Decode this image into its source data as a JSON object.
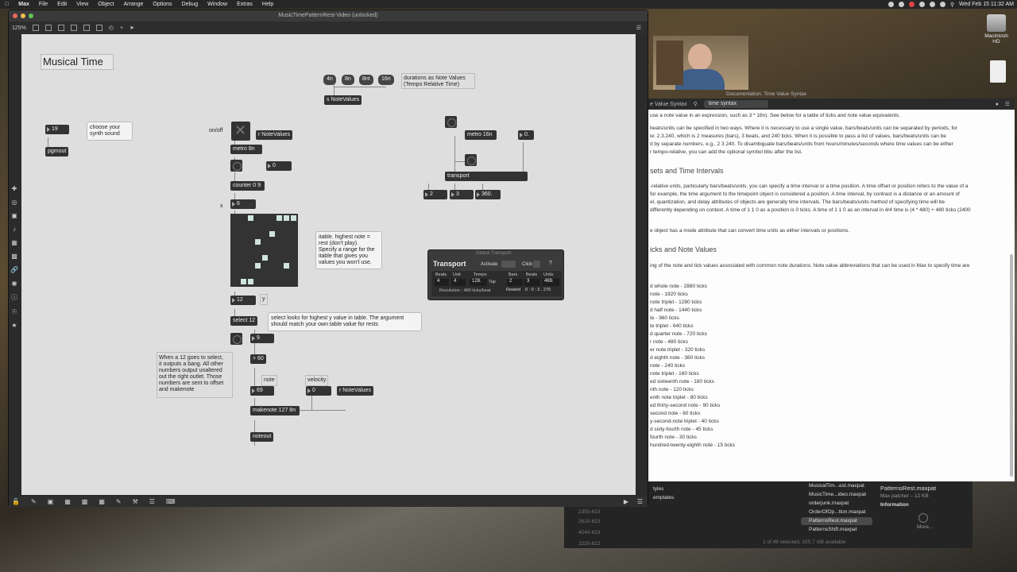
{
  "menubar": {
    "app": "Max",
    "items": [
      "File",
      "Edit",
      "View",
      "Object",
      "Arrange",
      "Options",
      "Debug",
      "Window",
      "Extras",
      "Help"
    ],
    "clock": "Wed Feb 15  11:32 AM"
  },
  "window": {
    "title": "MusicTimePatternRest-Video (unlocked)",
    "zoom": "125%"
  },
  "patch": {
    "heading": "Musical Time",
    "msg_4n": "4n",
    "msg_8n": "8n",
    "msg_8nt": "8nt",
    "msg_16n": "16n",
    "durations_comment": "durations as Note Values\n(Tempo Relative Time)",
    "s_notevalues": "s NoteValues",
    "num_19": "19",
    "pgmout": "pgmout",
    "synth_comment": "choose your\nsynth sound",
    "onoff": "on/off",
    "r_notevalues_1": "r NoteValues",
    "metro_8n": "metro 8n",
    "num_0_a": "0",
    "counter": "counter 0 9",
    "num_6": "6",
    "x_label": "x",
    "itable_comment": "itable. highest note =\nrest (don't play).\nSpecify a range for the\nitable that gives you\nvalues you won't use.",
    "num_12": "12",
    "y_label": "y",
    "select_12": "select 12",
    "select_comment": "select looks for highest y value in table. The argument\nshould match your own table value for rests",
    "num_9": "9",
    "plus_60": "+ 60",
    "bang_comment": "When a 12 goes to select,\nit outputs a bang. All other\nnumbers output unaltered\nout the right outlet. Those\nnumbers are sent to offset\nand makenote",
    "note_label": "note",
    "velocity_label": "velocity",
    "num_69": "69",
    "num_0_b": "0",
    "r_notevalues_2": "r NoteValues",
    "makenote": "makenote 127 8n",
    "noteout": "noteout",
    "metro_16n": "metro 16n",
    "num_0_c": "0.",
    "transport": "transport",
    "num_2": "2",
    "num_3": "3",
    "num_360": "360."
  },
  "global_transport": {
    "window_title": "Global Transport",
    "title": "Transport",
    "activate": "Activate",
    "click": "Click",
    "help": "?",
    "beats_label": "Beats",
    "unit_label": "Unit",
    "tempo_label": "Tempo",
    "bars_label": "Bars",
    "beats2_label": "Beats",
    "units_label": "Units",
    "beats_val": "4",
    "unit_val": "4",
    "tempo_val": "128.",
    "tap": "Tap",
    "bars_val": "2",
    "beats2_val": "3",
    "units_val": "469.",
    "resolution": "Resolution : 480 ticks/beat",
    "rewind": "Rewind",
    "time": "0 : 0 : 3 . 270"
  },
  "docs": {
    "window_title": "Documentation: Time Value Syntax",
    "tab": "e Value Syntax",
    "search_value": "time syntax",
    "para_top": "use a note value in an expression, such as 3 * 16n). See below for a table of ticks and note value equivalents.",
    "para_bbu_1": "beats/units can be specified in two ways. Where it is necessary to use a single value, bars/beats/units can be separated by periods, for",
    "para_bbu_2": "le: 2.3.240, which is 2 measures (bars), 3 beats, and 240 ticks. When it is possible to pass a list of values, bars/beats/units can be",
    "para_bbu_3": "d by separate numbers, e.g., 2 3 240. To disambiguate bars/beats/units from hours/minutes/seconds where time values can be either",
    "para_bbu_4": "r tempo-relative, you can add the optional symbol bbu after the list.",
    "heading_intervals": "sets and Time Intervals",
    "para_int_1": "-relative units, particularly bars/beats/units, you can specify a time interval or a time position. A time offset or position refers to the value of a",
    "para_int_2": "for example, the time argument to the timepoint object is considered a position. A time interval, by contrast is a distance or an amount of",
    "para_int_3": "el, quantization, and delay attributes of objects are generally time intervals. The bars/beats/units method of specifying time will be",
    "para_int_4": "differently depending on context. A time of 1 1 0 as a position is 0 ticks. A time of 1 1 0 as an interval in 4/4 time is (4 * 480) + 480 ticks (2400",
    "para_mode": "e object has a mode attribute that can convert time units as either intervals or positions.",
    "heading_ticks": "icks and Note Values",
    "para_ticks": "ing of the note and tick values associated with common note durations. Note value abbreviations that can be used in Max to specify time are",
    "ticks": [
      "d whole note - 2880 ticks",
      "note - 1920 ticks",
      "note triplet - 1280 ticks",
      "d half note - 1440 ticks",
      "te - 960 ticks",
      "te triplet - 640 ticks",
      "d quarter note - 720 ticks",
      "r note - 480 ticks",
      "er note triplet - 320 ticks",
      "d eighth note - 360 ticks",
      "note - 240 ticks",
      "note triplet - 160 ticks",
      "ed sixteenth note - 180 ticks",
      "nth note - 120 ticks",
      "enth note triplet - 80 ticks",
      "ed thirty-second note - 90 ticks",
      "second note - 60 ticks",
      "y-second-note triplet - 40 ticks",
      "d sixty-fourth note - 45 ticks",
      "fourth note - 30 ticks",
      "hundred-twenty-eighth note - 15 ticks"
    ]
  },
  "finder": {
    "files": [
      "MusicalTim...est.maxpat",
      "MusicTime...ideo.maxpat",
      "orderjunk.maxpat",
      "OrderOfOp...tton.maxpat",
      "PatternsRest.maxpat",
      "PatternsShift.maxpat"
    ],
    "sidebar": [
      "tyles",
      "emplates"
    ],
    "bg_items": [
      "2610-623",
      "4240-623",
      "2220-622",
      "2350-623"
    ],
    "selected_name": "PatternsRest.maxpat",
    "selected_meta": "Max patcher – 12 KB",
    "information": "Information",
    "more": "More...",
    "footer": "1 of 48 selected, 325.7 GB available"
  },
  "desktop": {
    "hd_label": "Macintosh HD"
  }
}
